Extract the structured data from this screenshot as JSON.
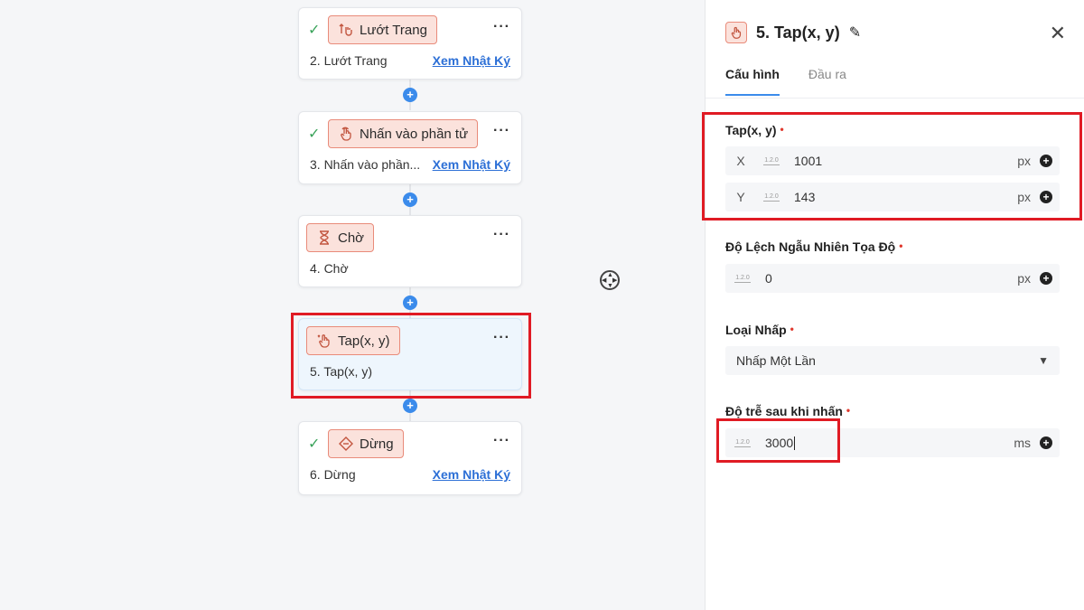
{
  "canvas": {
    "nodes": [
      {
        "pill_label": "Lướt Trang",
        "title": "2. Lướt Trang",
        "log_link": "Xem Nhật Ký",
        "checked": true
      },
      {
        "pill_label": "Nhấn vào phần tử",
        "title": "3. Nhấn vào phần...",
        "log_link": "Xem Nhật Ký",
        "checked": true
      },
      {
        "pill_label": "Chờ",
        "title": "4. Chờ",
        "log_link": "",
        "checked": false
      },
      {
        "pill_label": "Tap(x, y)",
        "title": "5. Tap(x, y)",
        "log_link": "",
        "checked": false,
        "selected": true
      },
      {
        "pill_label": "Dừng",
        "title": "6. Dừng",
        "log_link": "Xem Nhật Ký",
        "checked": true
      }
    ],
    "menu_glyph": "···",
    "add_glyph": "+",
    "check_glyph": "✓"
  },
  "panel": {
    "title": "5. Tap(x, y)",
    "tabs": [
      "Cấu hình",
      "Đầu ra"
    ],
    "active_tab": "Cấu hình",
    "tap_section": {
      "label": "Tap(x, y)",
      "x": {
        "axis": "X",
        "value": "1001",
        "unit": "px"
      },
      "y": {
        "axis": "Y",
        "value": "143",
        "unit": "px"
      }
    },
    "offset_section": {
      "label": "Độ Lệch Ngẫu Nhiên Tọa Độ",
      "value": "0",
      "unit": "px"
    },
    "click_type_section": {
      "label": "Loại Nhấp",
      "selected": "Nhấp Một Lần"
    },
    "delay_section": {
      "label": "Độ trễ sau khi nhấn",
      "value": "3000",
      "unit": "ms"
    },
    "number_icon_text": "1.2.0",
    "required_mark": "•"
  },
  "colors": {
    "accent": "#3b8beb",
    "highlight": "#e01b24",
    "pill_bg": "#fbe2dc",
    "pill_border": "#e98b7a",
    "link": "#2c6fd6"
  }
}
